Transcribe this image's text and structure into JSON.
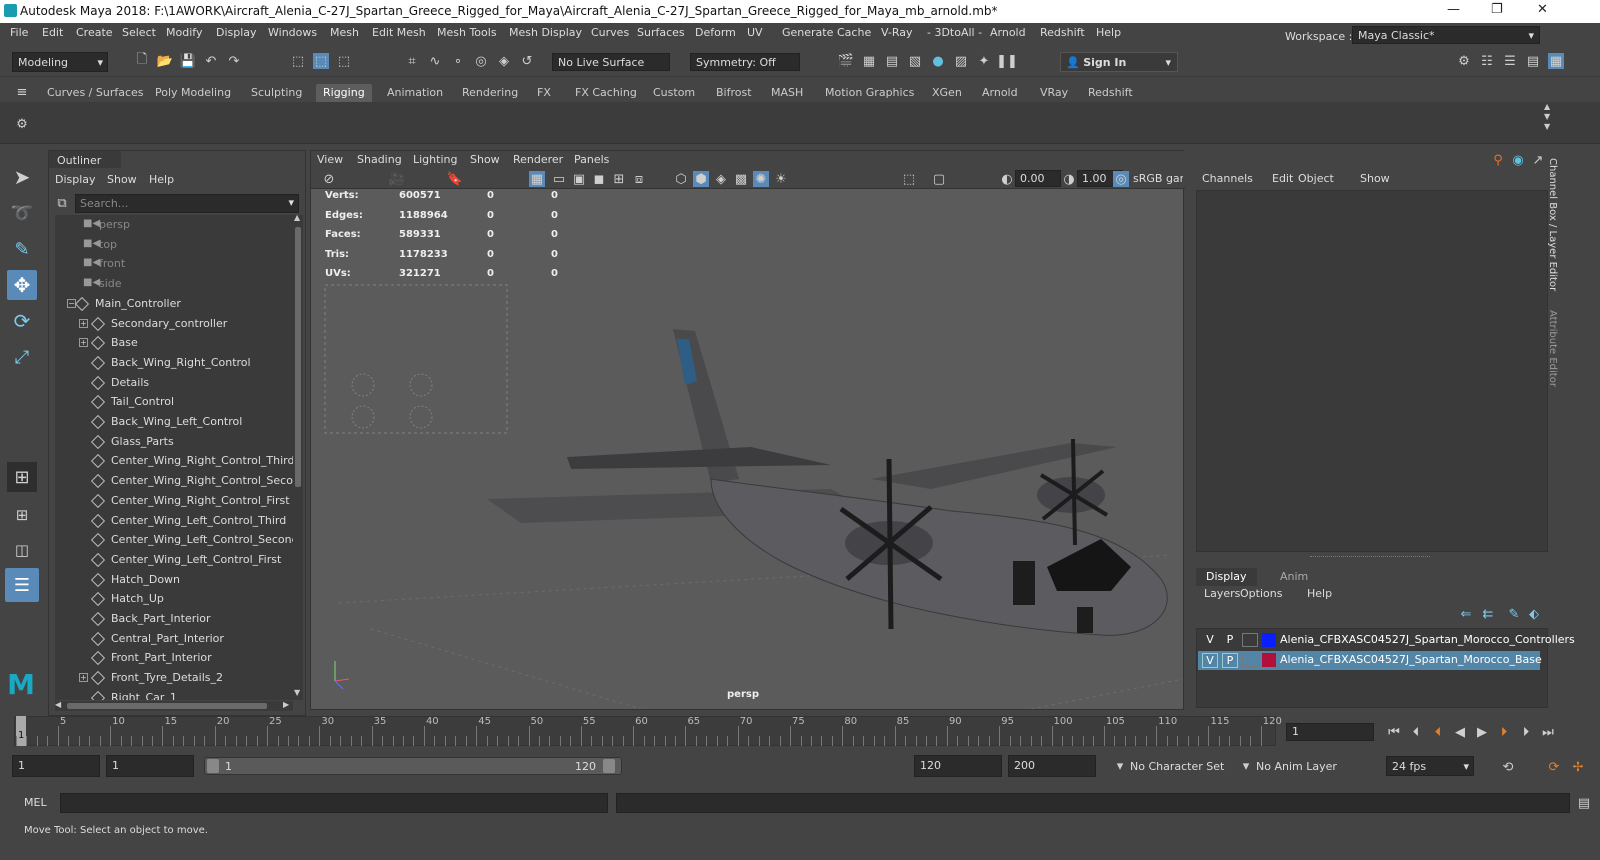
{
  "window": {
    "title": "Autodesk Maya 2018: F:\\1AWORK\\Aircraft_Alenia_C-27J_Spartan_Greece_Rigged_for_Maya\\Aircraft_Alenia_C-27J_Spartan_Greece_Rigged_for_Maya_mb_arnold.mb*"
  },
  "menu": [
    "File",
    "Edit",
    "Create",
    "Select",
    "Modify",
    "Display",
    "Windows",
    "Mesh",
    "Edit Mesh",
    "Mesh Tools",
    "Mesh Display",
    "Curves",
    "Surfaces",
    "Deform",
    "UV",
    "Generate",
    "Cache",
    "V-Ray",
    "- 3DtoAll -",
    "Arnold",
    "Redshift",
    "Help"
  ],
  "workspace": {
    "label": "Workspace :",
    "value": "Maya Classic*"
  },
  "status": {
    "mode": "Modeling",
    "live_surface": "No Live Surface",
    "symmetry": "Symmetry: Off",
    "sign_in": "Sign In"
  },
  "shelf_tabs": [
    "Curves / Surfaces",
    "Poly Modeling",
    "Sculpting",
    "Rigging",
    "Animation",
    "Rendering",
    "FX",
    "FX Caching",
    "Custom",
    "Bifrost",
    "MASH",
    "Motion Graphics",
    "XGen",
    "Arnold",
    "VRay",
    "Redshift"
  ],
  "outliner": {
    "title": "Outliner",
    "menu": [
      "Display",
      "Show",
      "Help"
    ],
    "search_placeholder": "Search...",
    "items": [
      {
        "label": "persp",
        "kind": "cam",
        "indent": 0
      },
      {
        "label": "top",
        "kind": "cam",
        "indent": 0
      },
      {
        "label": "front",
        "kind": "cam",
        "indent": 0
      },
      {
        "label": "side",
        "kind": "cam",
        "indent": 0
      },
      {
        "label": "Main_Controller",
        "kind": "node",
        "indent": 0,
        "expand": "−"
      },
      {
        "label": "Secondary_controller",
        "kind": "node",
        "indent": 1,
        "expand": "+"
      },
      {
        "label": "Base",
        "kind": "node",
        "indent": 1,
        "expand": "+"
      },
      {
        "label": "Back_Wing_Right_Control",
        "kind": "node",
        "indent": 1
      },
      {
        "label": "Details",
        "kind": "node",
        "indent": 1
      },
      {
        "label": "Tail_Control",
        "kind": "node",
        "indent": 1
      },
      {
        "label": "Back_Wing_Left_Control",
        "kind": "node",
        "indent": 1
      },
      {
        "label": "Glass_Parts",
        "kind": "node",
        "indent": 1
      },
      {
        "label": "Center_Wing_Right_Control_Third",
        "kind": "node",
        "indent": 1
      },
      {
        "label": "Center_Wing_Right_Control_Secor",
        "kind": "node",
        "indent": 1
      },
      {
        "label": "Center_Wing_Right_Control_First",
        "kind": "node",
        "indent": 1
      },
      {
        "label": "Center_Wing_Left_Control_Third",
        "kind": "node",
        "indent": 1
      },
      {
        "label": "Center_Wing_Left_Control_Second",
        "kind": "node",
        "indent": 1
      },
      {
        "label": "Center_Wing_Left_Control_First",
        "kind": "node",
        "indent": 1
      },
      {
        "label": "Hatch_Down",
        "kind": "node",
        "indent": 1
      },
      {
        "label": "Hatch_Up",
        "kind": "node",
        "indent": 1
      },
      {
        "label": "Back_Part_Interior",
        "kind": "node",
        "indent": 1
      },
      {
        "label": "Central_Part_Interior",
        "kind": "node",
        "indent": 1
      },
      {
        "label": "Front_Part_Interior",
        "kind": "node",
        "indent": 1
      },
      {
        "label": "Front_Tyre_Details_2",
        "kind": "node",
        "indent": 1,
        "expand": "+"
      },
      {
        "label": "Right_Car_1",
        "kind": "node",
        "indent": 1
      }
    ]
  },
  "viewport": {
    "menu": [
      "View",
      "Shading",
      "Lighting",
      "Show",
      "Renderer",
      "Panels"
    ],
    "camera": "persp",
    "field_a": "0.00",
    "field_b": "1.00",
    "colorspace": "sRGB gam",
    "hud": [
      {
        "label": "Verts:",
        "v1": "600571",
        "v2": "0",
        "v3": "0"
      },
      {
        "label": "Edges:",
        "v1": "1188964",
        "v2": "0",
        "v3": "0"
      },
      {
        "label": "Faces:",
        "v1": "589331",
        "v2": "0",
        "v3": "0"
      },
      {
        "label": "Tris:",
        "v1": "1178233",
        "v2": "0",
        "v3": "0"
      },
      {
        "label": "UVs:",
        "v1": "321271",
        "v2": "0",
        "v3": "0"
      }
    ]
  },
  "channelbox": {
    "menu": [
      "Channels",
      "Edit",
      "Object",
      "Show"
    ],
    "tabs": [
      "Display",
      "Anim"
    ],
    "layer_menu": [
      "Layers",
      "Options",
      "Help"
    ],
    "side_tabs": [
      "Channel Box / Layer Editor",
      "Attribute Editor"
    ],
    "layers": [
      {
        "v": "V",
        "p": "P",
        "color": "#0a1fff",
        "name": "Alenia_CFBXASC04527J_Spartan_Morocco_Controllers",
        "selected": false
      },
      {
        "v": "V",
        "p": "P",
        "color": "#b0103a",
        "name": "Alenia_CFBXASC04527J_Spartan_Morocco_Base",
        "selected": true
      }
    ]
  },
  "timeline": {
    "ticks": [
      "5",
      "10",
      "15",
      "20",
      "25",
      "30",
      "35",
      "40",
      "45",
      "50",
      "55",
      "60",
      "65",
      "70",
      "75",
      "80",
      "85",
      "90",
      "95",
      "100",
      "105",
      "110",
      "115",
      "120"
    ],
    "current_mark": "1",
    "current_frame": "1"
  },
  "range": {
    "start": "1",
    "start2": "1",
    "slider_start": "1",
    "slider_end": "120",
    "end": "120",
    "end2": "200",
    "character_set": "No Character Set",
    "anim_layer": "No Anim Layer",
    "fps": "24 fps"
  },
  "cmdline": {
    "label": "MEL"
  },
  "helpline": {
    "text": "Move Tool: Select an object to move."
  }
}
